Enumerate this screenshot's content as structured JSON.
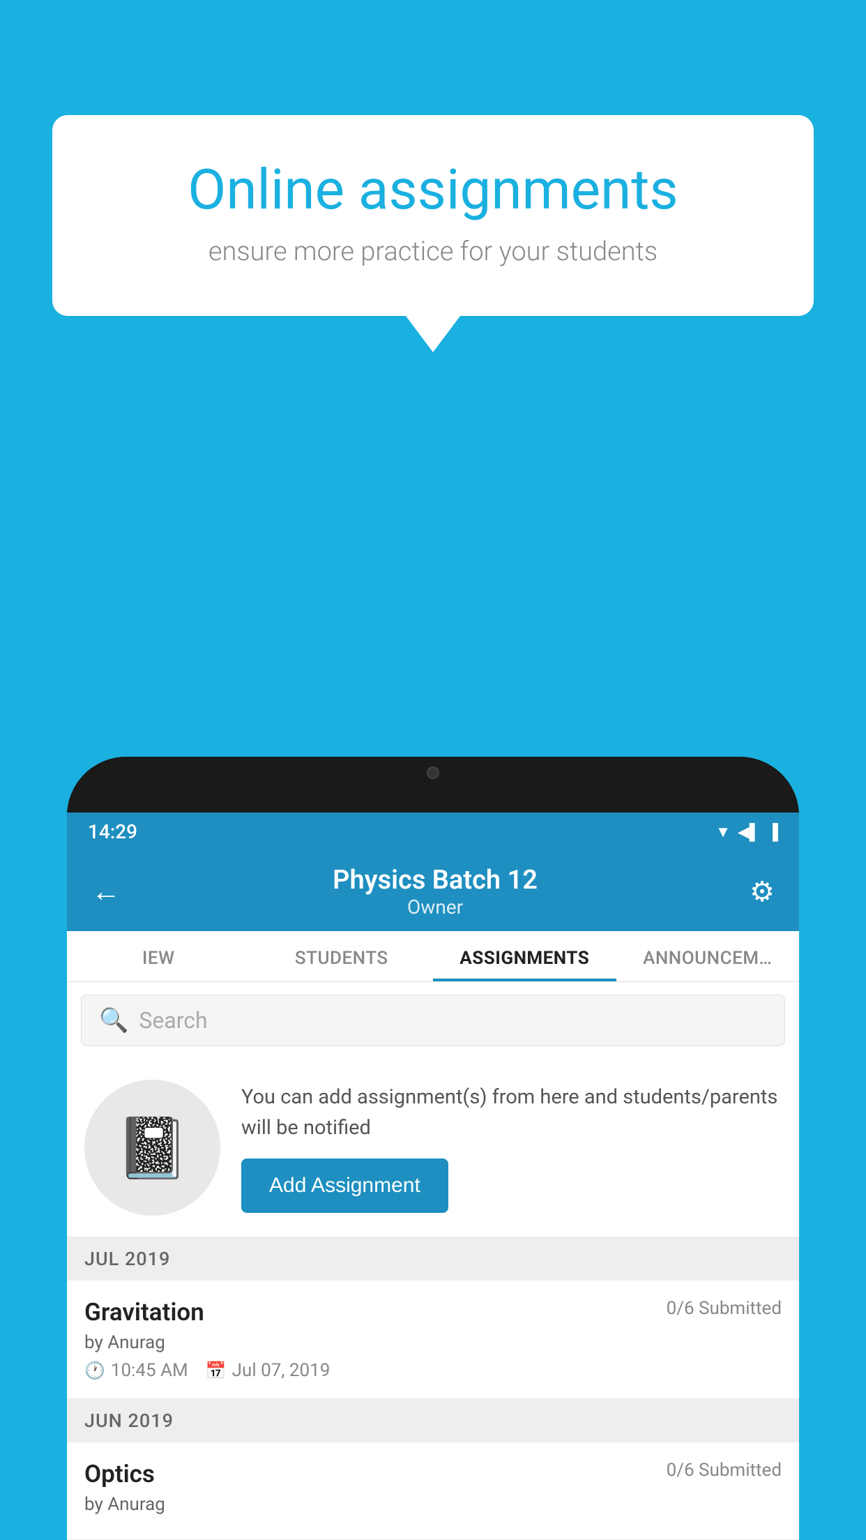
{
  "background": {
    "color": "#1ab0e0"
  },
  "speech_bubble": {
    "title": "Online assignments",
    "subtitle": "ensure more practice for your students"
  },
  "phone": {
    "status_bar": {
      "time": "14:29"
    },
    "header": {
      "title": "Physics Batch 12",
      "subtitle": "Owner",
      "back_label": "←",
      "settings_label": "⚙"
    },
    "tabs": [
      {
        "label": "IEW",
        "active": false
      },
      {
        "label": "STUDENTS",
        "active": false
      },
      {
        "label": "ASSIGNMENTS",
        "active": true
      },
      {
        "label": "ANNOUNCEM…",
        "active": false
      }
    ],
    "search": {
      "placeholder": "Search"
    },
    "promo": {
      "description": "You can add assignment(s) from here and students/parents will be notified",
      "button_label": "Add Assignment"
    },
    "month_sections": [
      {
        "month": "JUL 2019",
        "assignments": [
          {
            "title": "Gravitation",
            "submitted": "0/6 Submitted",
            "author": "by Anurag",
            "time": "10:45 AM",
            "date": "Jul 07, 2019"
          }
        ]
      },
      {
        "month": "JUN 2019",
        "assignments": [
          {
            "title": "Optics",
            "submitted": "0/6 Submitted",
            "author": "by Anurag",
            "time": "",
            "date": ""
          }
        ]
      }
    ]
  }
}
